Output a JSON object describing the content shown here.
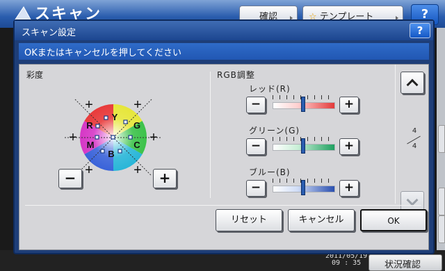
{
  "background": {
    "app_title": "スキャン",
    "confirm_label": "確認",
    "template_label": "テンプレート",
    "help_label": "?",
    "datetime_top": "2011/05/19",
    "datetime_bottom": "09 : 35",
    "status_label": "状況確認"
  },
  "dialog": {
    "title": "スキャン設定",
    "help_label": "?",
    "message": "OKまたはキャンセルを押してください",
    "saturation": {
      "label": "彩度",
      "wheel_letters": {
        "R": "R",
        "Y": "Y",
        "G": "G",
        "M": "M",
        "C": "C",
        "B": "B"
      },
      "minus_label": "−",
      "plus_label": "+"
    },
    "rgb": {
      "label": "RGB調整",
      "channels": [
        {
          "name": "レッド(R)",
          "minus": "−",
          "plus": "+",
          "level": 0.5,
          "color": "#e33a3a"
        },
        {
          "name": "グリーン(G)",
          "minus": "−",
          "plus": "+",
          "level": 0.5,
          "color": "#1ea060"
        },
        {
          "name": "ブルー(B)",
          "minus": "−",
          "plus": "+",
          "level": 0.5,
          "color": "#2a4fb0"
        }
      ]
    },
    "pagination": {
      "current": "4",
      "total": "4"
    },
    "buttons": {
      "reset": "リセット",
      "cancel": "キャンセル",
      "ok": "OK"
    }
  },
  "colors": {
    "accent": "#2157b3",
    "titlebar": "#1c4690",
    "panel": "#d6d6d9"
  }
}
